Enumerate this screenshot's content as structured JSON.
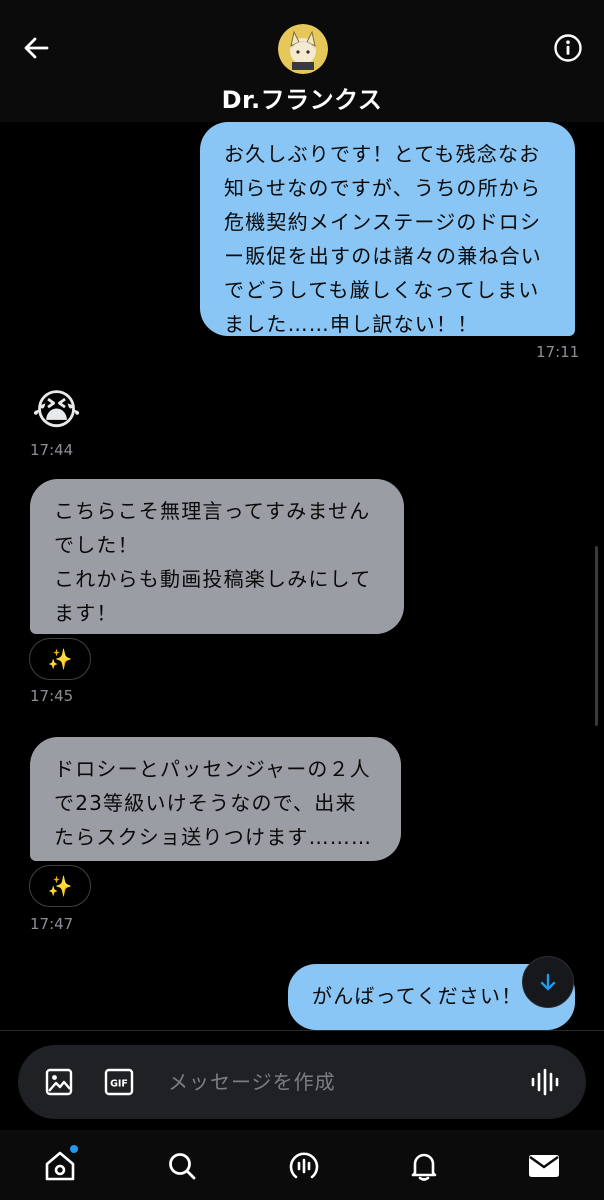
{
  "header": {
    "title": "Dr.フランクス",
    "back_icon": "arrow-left-icon",
    "info_icon": "info-icon"
  },
  "messages": {
    "m1": {
      "lines": [
        "お久しぶりです！とても残念なお",
        "知らせなのですが、うちの所から",
        "危機契約メインステージのドロシ",
        "ー販促を出すのは諸々の兼ね合い",
        "でどうしても厳しくなってしまい",
        "ました……申し訳ない！！"
      ],
      "time": "17:11"
    },
    "m2": {
      "emoji": "😭",
      "time": "17:44"
    },
    "m3": {
      "lines": [
        "こちらこそ無理言ってすみません",
        "でした！",
        "これからも動画投稿楽しみにして",
        "ます！"
      ],
      "reaction": "✨",
      "time": "17:45"
    },
    "m4": {
      "lines": [
        "ドロシーとパッセンジャーの２人",
        "で23等級いけそうなので、出来",
        "たらスクショ送りつけます………"
      ],
      "reaction": "✨",
      "time": "17:47"
    },
    "m5": {
      "lines": [
        "がんばってください！"
      ]
    }
  },
  "composer": {
    "placeholder": "メッセージを作成",
    "gif_label": "GIF"
  },
  "colors": {
    "sent_bubble": "#8ac6f5",
    "received_bubble": "#9a9ea4",
    "accent": "#1d9bf0"
  }
}
